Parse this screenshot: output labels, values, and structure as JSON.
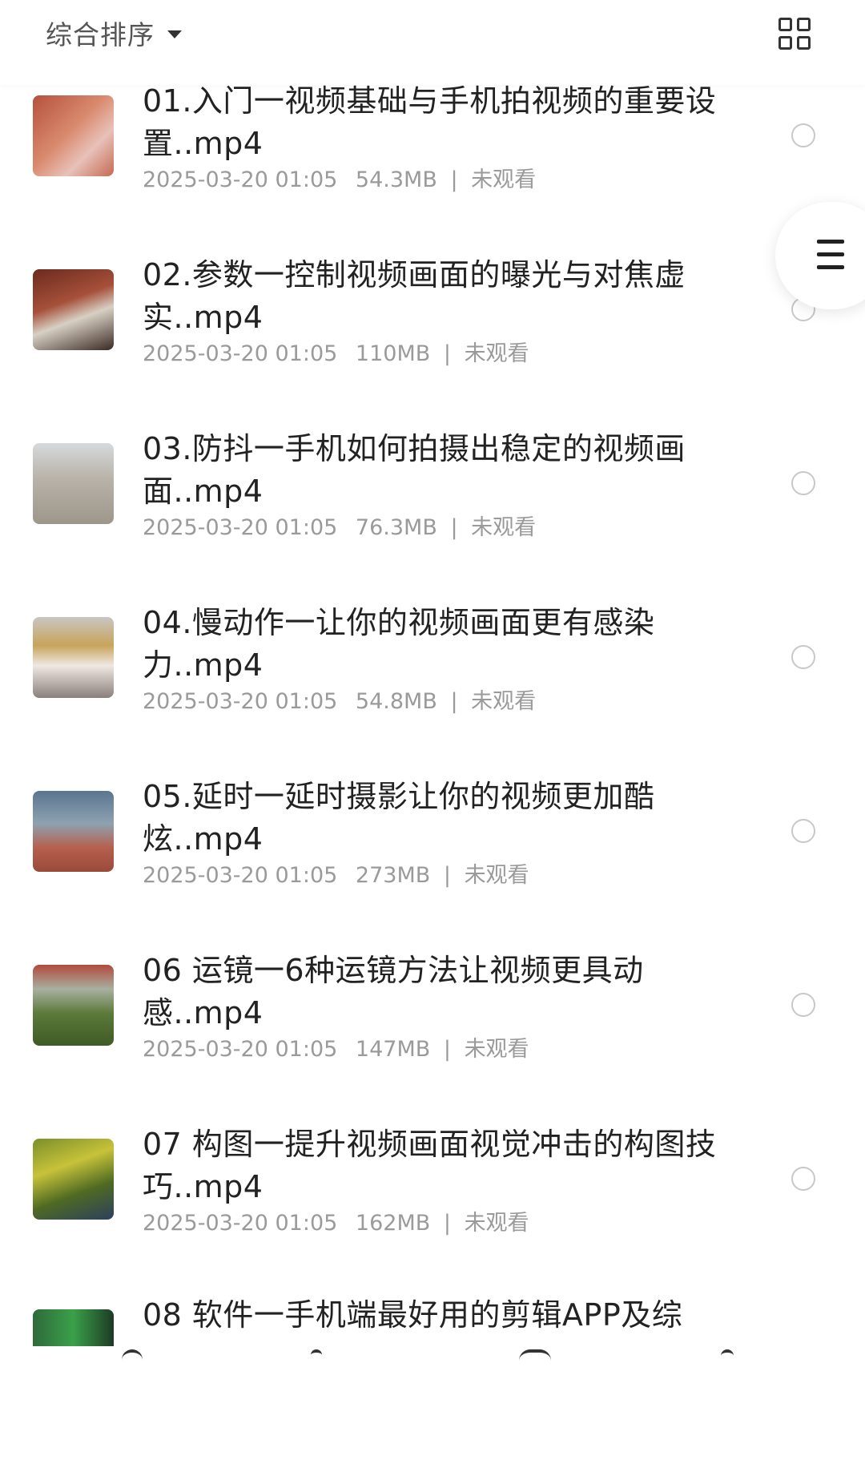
{
  "toolbar": {
    "sort_label": "综合排序",
    "sort_icon": "caret-down-icon",
    "view_toggle_icon": "grid-view-icon"
  },
  "float_menu": {
    "icon": "menu-icon"
  },
  "files": [
    {
      "title": "01.入门一视频基础与手机拍视频的重要设置..mp4",
      "date": "2025-03-20 01:05",
      "size": "54.3MB",
      "status": "未观看"
    },
    {
      "title": "02.参数一控制视频画面的曝光与对焦虚实..mp4",
      "date": "2025-03-20 01:05",
      "size": "110MB",
      "status": "未观看"
    },
    {
      "title": "03.防抖一手机如何拍摄出稳定的视频画面..mp4",
      "date": "2025-03-20 01:05",
      "size": "76.3MB",
      "status": "未观看"
    },
    {
      "title": "04.慢动作一让你的视频画面更有感染力..mp4",
      "date": "2025-03-20 01:05",
      "size": "54.8MB",
      "status": "未观看"
    },
    {
      "title": "05.延时一延时摄影让你的视频更加酷炫..mp4",
      "date": "2025-03-20 01:05",
      "size": "273MB",
      "status": "未观看"
    },
    {
      "title": "06 运镜一6种运镜方法让视频更具动感..mp4",
      "date": "2025-03-20 01:05",
      "size": "147MB",
      "status": "未观看"
    },
    {
      "title": "07 构图一提升视频画面视觉冲击的构图技巧..mp4",
      "date": "2025-03-20 01:05",
      "size": "162MB",
      "status": "未观看"
    },
    {
      "title": "08 软件一手机端最好用的剪辑APP及综",
      "date": "",
      "size": "",
      "status": ""
    }
  ],
  "thumb_colors": [
    "#b5503d",
    "#8c3b2a",
    "#9a9a90",
    "#c9c2b8",
    "#a34b3f",
    "#5c7a3a",
    "#6b7d2a",
    "#3a8a4a"
  ]
}
